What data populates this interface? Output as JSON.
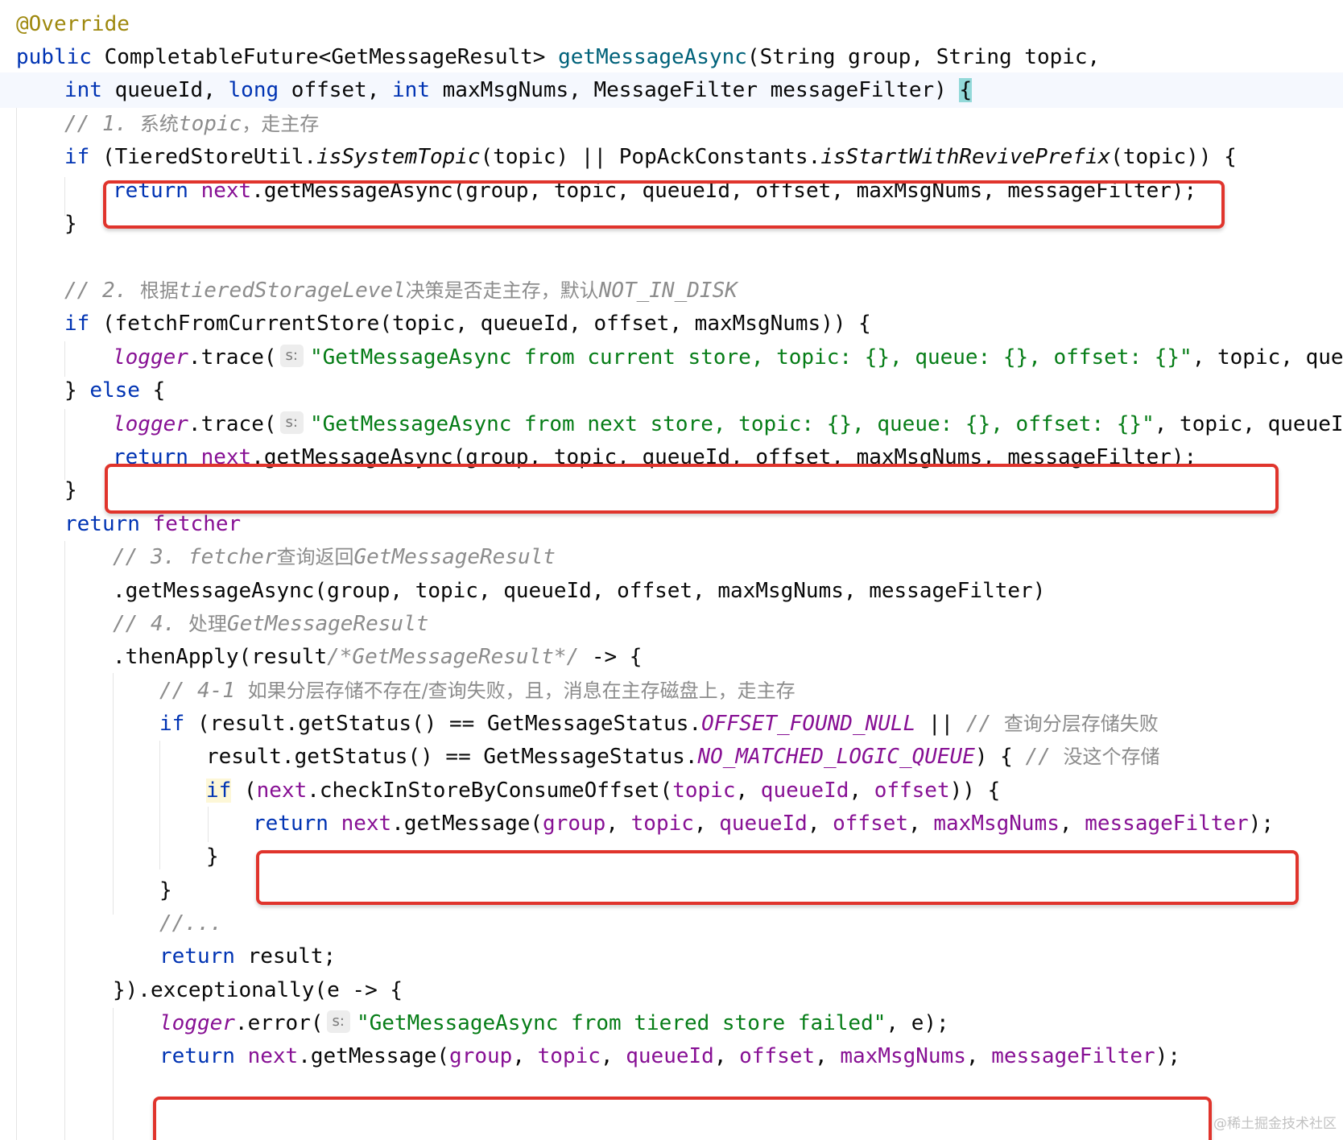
{
  "code": {
    "l01_annotation": "@Override",
    "l02_public": "public",
    "l02_type": " CompletableFuture<GetMessageResult> ",
    "l02_method": "getMessageAsync",
    "l02_rest": "(String group, String topic,",
    "l03_int1": "int",
    "l03_a": " queueId, ",
    "l03_long": "long",
    "l03_b": " offset, ",
    "l03_int2": "int",
    "l03_c": " maxMsgNums, MessageFilter messageFilter) ",
    "l03_brace": "{",
    "l04_comment_a": "// 1. ",
    "l04_comment_cn1": "系统",
    "l04_comment_b": "topic",
    "l04_comment_cn2": "，走主存",
    "l05_if": "if",
    "l05_a": " (TieredStoreUtil.",
    "l05_m1": "isSystemTopic",
    "l05_b": "(topic) || PopAckConstants.",
    "l05_m2": "isStartWithRevivePrefix",
    "l05_c": "(topic)) {",
    "l06_return": "return",
    "l06_next": "next",
    "l06_rest": ".getMessageAsync(group, topic, queueId, offset, maxMsgNums, messageFilter);",
    "l07": "}",
    "l09_comment_a": "// 2. ",
    "l09_comment_cn1": "根据",
    "l09_comment_b": "tieredStorageLevel",
    "l09_comment_cn2": "决策是否走主存，默认",
    "l09_comment_c": "NOT_IN_DISK",
    "l10_if": "if",
    "l10_rest": " (fetchFromCurrentStore(topic, queueId, offset, maxMsgNums)) {",
    "l11_logger": "logger",
    "l11_trace": ".trace(",
    "l11_hint": "s:",
    "l11_str": "\"GetMessageAsync from current store, topic: {}, queue: {}, offset: {}\"",
    "l11_rest": ", topic, que",
    "l12_close": "} ",
    "l12_else": "else",
    "l12_open": " {",
    "l13_logger": "logger",
    "l13_trace": ".trace(",
    "l13_hint": "s:",
    "l13_str": "\"GetMessageAsync from next store, topic: {}, queue: {}, offset: {}\"",
    "l13_rest": ", topic, queueI",
    "l14_return": "return",
    "l14_next": "next",
    "l14_rest": ".getMessageAsync(group, topic, queueId, offset, maxMsgNums, messageFilter);",
    "l15": "}",
    "l16_return": "return",
    "l16_fetcher": "fetcher",
    "l17_comment_a": "// 3. fetcher",
    "l17_comment_cn": "查询返回",
    "l17_comment_b": "GetMessageResult",
    "l18": ".getMessageAsync(group, topic, queueId, offset, maxMsgNums, messageFilter)",
    "l19_comment_a": "// 4. ",
    "l19_comment_cn": "处理",
    "l19_comment_b": "GetMessageResult",
    "l20_a": ".thenApply(result",
    "l20_cmt": "/*GetMessageResult*/",
    "l20_b": " -> {",
    "l21_comment_a": "// 4-1 ",
    "l21_comment_cn": "如果分层存储不存在/查询失败，且，消息在主存磁盘上，走主存",
    "l22_if": "if",
    "l22_a": " (result.getStatus() == GetMessageStatus.",
    "l22_const": "OFFSET_FOUND_NULL",
    "l22_b": " || ",
    "l22_cmt_a": "// ",
    "l22_cmt_cn": "查询分层存储失败",
    "l23_a": "result.getStatus() == GetMessageStatus.",
    "l23_const": "NO_MATCHED_LOGIC_QUEUE",
    "l23_b": ") { ",
    "l23_cmt_a": "// ",
    "l23_cmt_cn": "没这个存储",
    "l24_if": "if",
    "l24_a": " (",
    "l24_next": "next",
    "l24_b": ".checkInStoreByConsumeOffset(",
    "l24_p1": "topic",
    "l24_s1": ", ",
    "l24_p2": "queueId",
    "l24_s2": ", ",
    "l24_p3": "offset",
    "l24_c": ")) {",
    "l25_return": "return",
    "l25_next": "next",
    "l25_a": ".getMessage(",
    "l25_p1": "group",
    "l25_p2": "topic",
    "l25_p3": "queueId",
    "l25_p4": "offset",
    "l25_p5": "maxMsgNums",
    "l25_p6": "messageFilter",
    "l25_sep": ", ",
    "l25_end": ");",
    "l26": "}",
    "l27": "}",
    "l28": "//...",
    "l29_return": "return",
    "l29_rest": " result;",
    "l30": "}).exceptionally(e -> {",
    "l31_logger": "logger",
    "l31_error": ".error(",
    "l31_hint": "s:",
    "l31_str": "\"GetMessageAsync from tiered store failed\"",
    "l31_rest": ", e);",
    "l32_return": "return",
    "l32_next": "next",
    "l32_a": ".getMessage(",
    "l32_p1": "group",
    "l32_p2": "topic",
    "l32_p3": "queueId",
    "l32_p4": "offset",
    "l32_p5": "maxMsgNums",
    "l32_p6": "messageFilter",
    "l32_sep": ", ",
    "l32_end": ");"
  },
  "watermark": "@稀土掘金技术社区",
  "colors": {
    "keyword": "#0033b3",
    "annotation": "#9e880d",
    "method": "#00627a",
    "comment": "#8c8c8c",
    "field": "#871094",
    "string": "#067d17",
    "highlight_box": "#e0342c",
    "brace_match": "#93d9d9"
  }
}
